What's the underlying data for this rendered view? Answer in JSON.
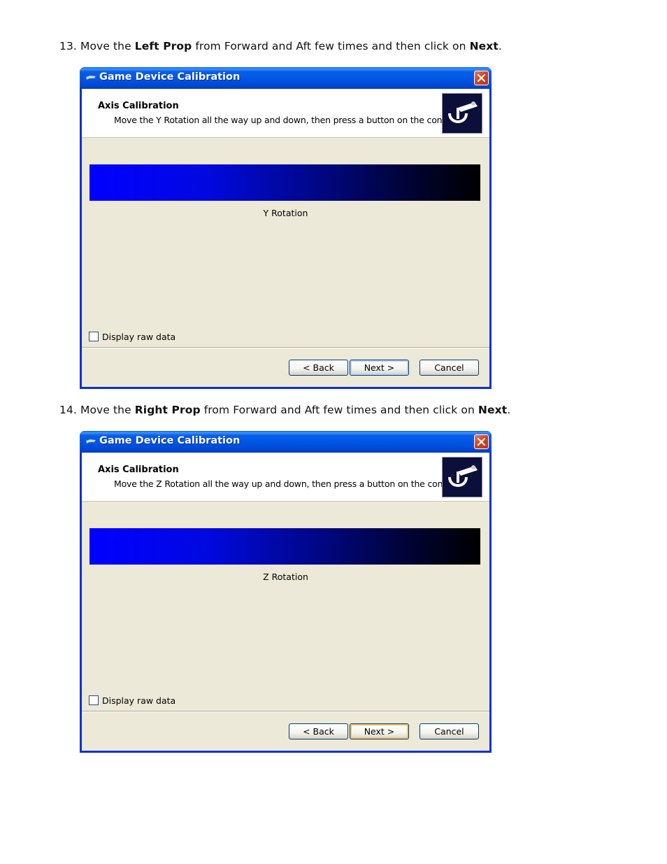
{
  "steps": [
    {
      "instruction": {
        "number": "13.",
        "pre": "Move the",
        "bold1": "Left Prop",
        "mid": "from Forward and Aft few times and then click on",
        "bold2": "Next",
        "end": "."
      },
      "dialog": {
        "title": "Game Device Calibration",
        "header_title": "Axis Calibration",
        "header_subtitle": "Move the Y Rotation all the way up and down, then press a button on the controller.",
        "axis_label": "Y Rotation",
        "raw_data_label": "Display raw data",
        "raw_data_checked": false,
        "buttons": {
          "back": "< Back",
          "next": "Next >",
          "cancel": "Cancel"
        }
      }
    },
    {
      "instruction": {
        "number": "14.",
        "pre": "Move the",
        "bold1": "Right Prop",
        "mid": "from Forward and Aft few times and then click on",
        "bold2": "Next",
        "end": "."
      },
      "dialog": {
        "title": "Game Device Calibration",
        "header_title": "Axis Calibration",
        "header_subtitle": "Move the Z Rotation all the way up and down, then press a button on the controller.",
        "axis_label": "Z Rotation",
        "raw_data_label": "Display raw data",
        "raw_data_checked": false,
        "buttons": {
          "back": "< Back",
          "next": "Next >",
          "cancel": "Cancel"
        }
      }
    }
  ]
}
